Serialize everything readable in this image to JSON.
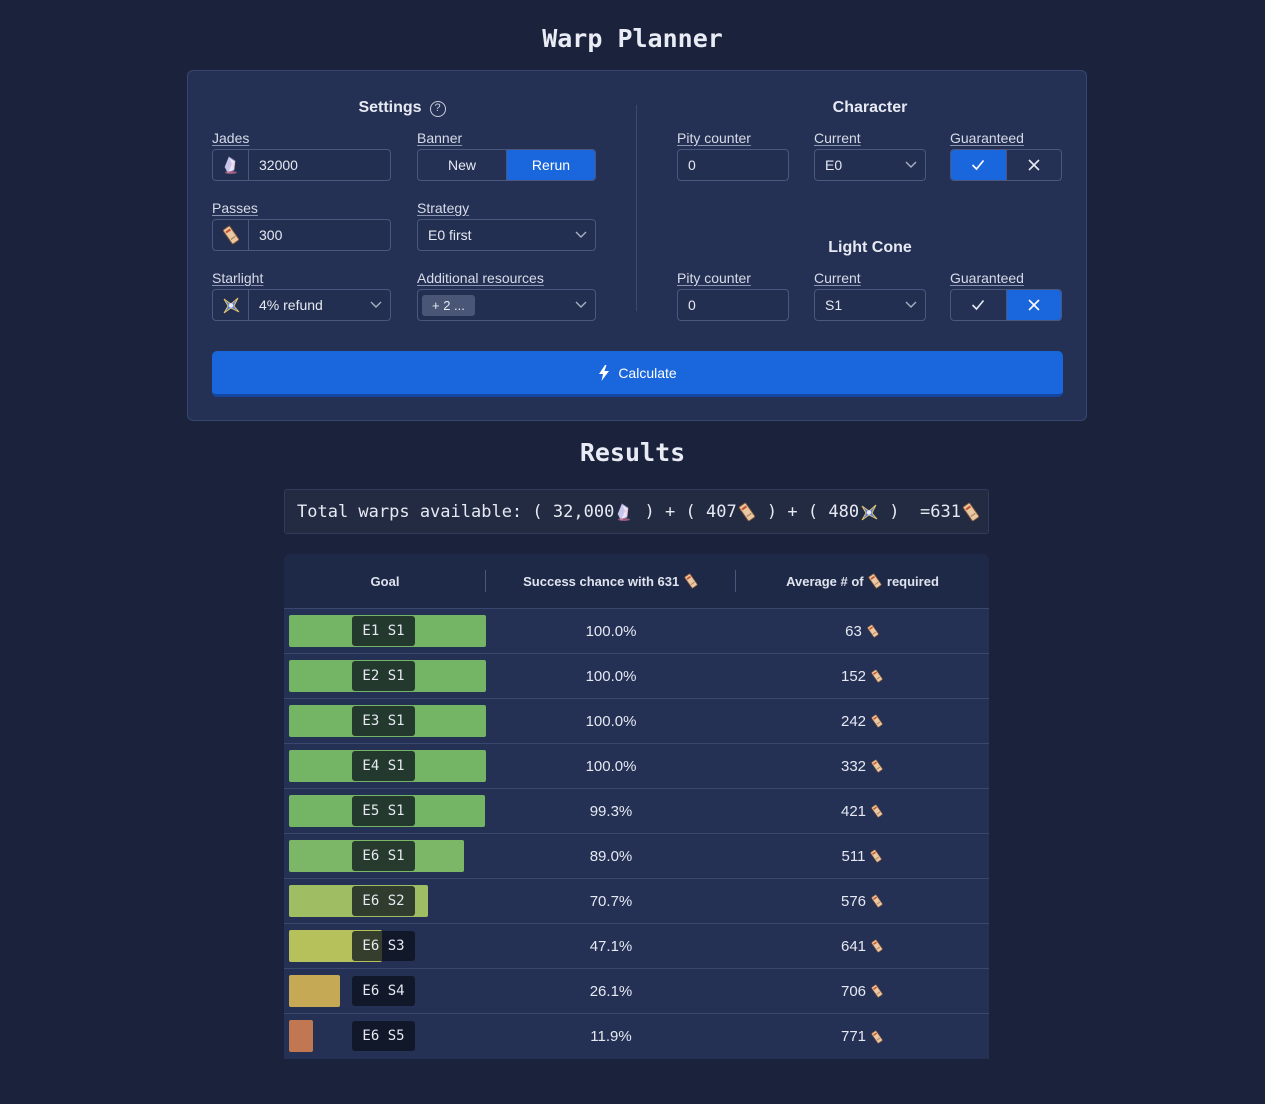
{
  "title": "Warp Planner",
  "settings": {
    "title": "Settings",
    "jades": {
      "label": "Jades",
      "value": "32000",
      "icon": "jade-icon"
    },
    "banner": {
      "label": "Banner",
      "options": [
        "New",
        "Rerun"
      ],
      "selected": "Rerun"
    },
    "passes": {
      "label": "Passes",
      "value": "300",
      "icon": "pass-icon"
    },
    "strategy": {
      "label": "Strategy",
      "value": "E0 first"
    },
    "starlight": {
      "label": "Starlight",
      "value": "4% refund",
      "icon": "starlight-icon"
    },
    "additional": {
      "label": "Additional resources",
      "value": "+ 2 ..."
    }
  },
  "character": {
    "title": "Character",
    "pity_label": "Pity counter",
    "pity_value": "0",
    "current_label": "Current",
    "current_value": "E0",
    "guaranteed_label": "Guaranteed",
    "guaranteed": true
  },
  "light_cone": {
    "title": "Light Cone",
    "pity_label": "Pity counter",
    "pity_value": "0",
    "current_label": "Current",
    "current_value": "S1",
    "guaranteed_label": "Guaranteed",
    "guaranteed": false
  },
  "calculate_label": "Calculate",
  "results": {
    "title": "Results",
    "total_label": "Total warps available:",
    "jades_value": "32,000",
    "passes_value": "407",
    "starlight_value": "480",
    "equals": "=",
    "total_value": "631",
    "headers": {
      "goal": "Goal",
      "success": "Success chance with 631",
      "average_pre": "Average # of",
      "average_post": "required"
    },
    "rows": [
      {
        "goal": "E1 S1",
        "chance": "100.0%",
        "avg": "63",
        "fraction": 1.0,
        "color": "#74b465"
      },
      {
        "goal": "E2 S1",
        "chance": "100.0%",
        "avg": "152",
        "fraction": 1.0,
        "color": "#74b465"
      },
      {
        "goal": "E3 S1",
        "chance": "100.0%",
        "avg": "242",
        "fraction": 1.0,
        "color": "#74b465"
      },
      {
        "goal": "E4 S1",
        "chance": "100.0%",
        "avg": "332",
        "fraction": 1.0,
        "color": "#74b465"
      },
      {
        "goal": "E5 S1",
        "chance": "99.3%",
        "avg": "421",
        "fraction": 0.993,
        "color": "#74b465"
      },
      {
        "goal": "E6 S1",
        "chance": "89.0%",
        "avg": "511",
        "fraction": 0.89,
        "color": "#7bb766"
      },
      {
        "goal": "E6 S2",
        "chance": "70.7%",
        "avg": "576",
        "fraction": 0.707,
        "color": "#9fbe64"
      },
      {
        "goal": "E6 S3",
        "chance": "47.1%",
        "avg": "641",
        "fraction": 0.471,
        "color": "#b7c15b"
      },
      {
        "goal": "E6 S4",
        "chance": "26.1%",
        "avg": "706",
        "fraction": 0.261,
        "color": "#c6a955"
      },
      {
        "goal": "E6 S5",
        "chance": "11.9%",
        "avg": "771",
        "fraction": 0.119,
        "color": "#c07752"
      }
    ]
  }
}
